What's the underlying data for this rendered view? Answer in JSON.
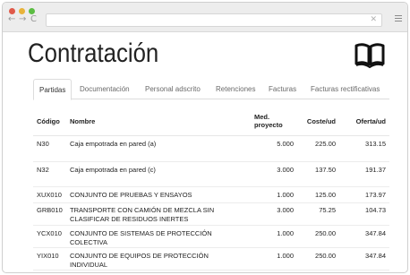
{
  "browser": {
    "back_glyph": "←",
    "forward_glyph": "→",
    "reload_glyph": "C",
    "address_close": "✕"
  },
  "page": {
    "title": "Contratación"
  },
  "tabs": [
    {
      "label": "Partidas",
      "active": true
    },
    {
      "label": "Documentación",
      "active": false
    },
    {
      "label": "Personal adscrito",
      "active": false
    },
    {
      "label": "Retenciones",
      "active": false
    },
    {
      "label": "Facturas",
      "active": false
    },
    {
      "label": "Facturas rectificativas",
      "active": false
    }
  ],
  "table": {
    "headers": {
      "codigo": "Código",
      "nombre": "Nombre",
      "medicion_line1": "Med.",
      "medicion_line2": "proyecto",
      "coste": "Coste/ud",
      "oferta": "Oferta/ud"
    },
    "rows": [
      {
        "codigo": "N30",
        "nombre": "Caja empotrada en pared (a)",
        "medicion": "5.000",
        "coste": "225.00",
        "oferta": "313.15"
      },
      {
        "codigo": "N32",
        "nombre": "Caja empotrada en pared (c)",
        "medicion": "3.000",
        "coste": "137.50",
        "oferta": "191.37"
      },
      {
        "codigo": "XUX010",
        "nombre": "CONJUNTO DE PRUEBAS Y ENSAYOS",
        "medicion": "1.000",
        "coste": "125.00",
        "oferta": "173.97"
      },
      {
        "codigo": "GRB010",
        "nombre": "TRANSPORTE CON CAMIÓN DE MEZCLA SIN CLASIFICAR DE RESIDUOS INERTES",
        "medicion": "3.000",
        "coste": "75.25",
        "oferta": "104.73"
      },
      {
        "codigo": "YCX010",
        "nombre": "CONJUNTO DE SISTEMAS DE PROTECCIÓN COLECTIVA",
        "medicion": "1.000",
        "coste": "250.00",
        "oferta": "347.84"
      },
      {
        "codigo": "YIX010",
        "nombre": "CONJUNTO DE EQUIPOS DE PROTECCIÓN INDIVIDUAL",
        "medicion": "1.000",
        "coste": "250.00",
        "oferta": "347.84"
      }
    ]
  },
  "icons": {
    "book": "book-icon"
  },
  "colors": {
    "traffic_red": "#e05a4a",
    "traffic_yellow": "#e8b33a",
    "traffic_green": "#5cbd43"
  }
}
